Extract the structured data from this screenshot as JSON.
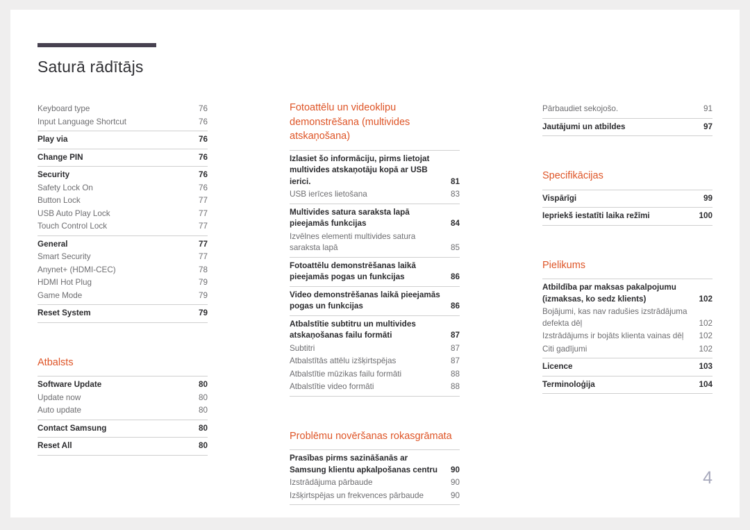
{
  "document": {
    "title": "Saturā rādītājs",
    "folio": "4",
    "accent_color": "#de5426",
    "rule_color": "#474150"
  },
  "columns": [
    {
      "name": "column-left",
      "blocks": [
        {
          "type": "group",
          "rule_top": false,
          "entries": [
            {
              "level": 2,
              "label": "Keyboard type",
              "page": "76"
            },
            {
              "level": 2,
              "label": "Input Language Shortcut",
              "page": "76"
            }
          ]
        },
        {
          "type": "group",
          "rule_top": true,
          "entries": [
            {
              "level": 1,
              "label": "Play via",
              "page": "76"
            }
          ]
        },
        {
          "type": "group",
          "rule_top": true,
          "entries": [
            {
              "level": 1,
              "label": "Change PIN",
              "page": "76"
            }
          ]
        },
        {
          "type": "group",
          "rule_top": true,
          "entries": [
            {
              "level": 1,
              "label": "Security",
              "page": "76"
            },
            {
              "level": 2,
              "label": "Safety Lock On",
              "page": "76"
            },
            {
              "level": 2,
              "label": "Button Lock",
              "page": "77"
            },
            {
              "level": 2,
              "label": "USB Auto Play Lock",
              "page": "77"
            },
            {
              "level": 2,
              "label": "Touch Control Lock",
              "page": "77"
            }
          ]
        },
        {
          "type": "group",
          "rule_top": true,
          "entries": [
            {
              "level": 1,
              "label": "General",
              "page": "77"
            },
            {
              "level": 2,
              "label": "Smart Security",
              "page": "77"
            },
            {
              "level": 2,
              "label": "Anynet+ (HDMI-CEC)",
              "page": "78"
            },
            {
              "level": 2,
              "label": "HDMI Hot Plug",
              "page": "79"
            },
            {
              "level": 2,
              "label": "Game Mode",
              "page": "79"
            }
          ]
        },
        {
          "type": "group",
          "rule_top": true,
          "entries": [
            {
              "level": 1,
              "label": "Reset System",
              "page": "79"
            }
          ]
        },
        {
          "type": "heading",
          "text": "Atbalsts",
          "spaced": true
        },
        {
          "type": "group",
          "rule_top": true,
          "entries": [
            {
              "level": 1,
              "label": "Software Update",
              "page": "80"
            },
            {
              "level": 2,
              "label": "Update now",
              "page": "80"
            },
            {
              "level": 2,
              "label": "Auto update",
              "page": "80"
            }
          ]
        },
        {
          "type": "group",
          "rule_top": true,
          "entries": [
            {
              "level": 1,
              "label": "Contact Samsung",
              "page": "80"
            }
          ]
        },
        {
          "type": "group",
          "rule_top": true,
          "entries": [
            {
              "level": 1,
              "label": "Reset All",
              "page": "80"
            }
          ]
        }
      ]
    },
    {
      "name": "column-middle",
      "blocks": [
        {
          "type": "heading",
          "text": "Fotoattēlu un videoklipu demonstrēšana (multivides atskaņošana)",
          "spaced": false
        },
        {
          "type": "group",
          "rule_top": true,
          "entries": [
            {
              "level": 1,
              "label": "Izlasiet šo informāciju, pirms lietojat multivides atskaņotāju kopā ar USB ierici.",
              "page": "81"
            },
            {
              "level": 2,
              "label": "USB ierīces lietošana",
              "page": "83"
            }
          ]
        },
        {
          "type": "group",
          "rule_top": true,
          "entries": [
            {
              "level": 1,
              "label": "Multivides satura saraksta lapā pieejamās funkcijas",
              "page": "84"
            },
            {
              "level": 2,
              "label": "Izvēlnes elementi multivides satura saraksta lapā",
              "page": "85"
            }
          ]
        },
        {
          "type": "group",
          "rule_top": true,
          "entries": [
            {
              "level": 1,
              "label": "Fotoattēlu demonstrēšanas laikā pieejamās pogas un funkcijas",
              "page": "86"
            }
          ]
        },
        {
          "type": "group",
          "rule_top": true,
          "entries": [
            {
              "level": 1,
              "label": "Video demonstrēšanas laikā pieejamās pogas un funkcijas",
              "page": "86"
            }
          ]
        },
        {
          "type": "group",
          "rule_top": true,
          "entries": [
            {
              "level": 1,
              "label": "Atbalstītie subtitru un multivides atskaņošanas failu formāti",
              "page": "87"
            },
            {
              "level": 2,
              "label": "Subtitri",
              "page": "87"
            },
            {
              "level": 2,
              "label": "Atbalstītās attēlu izšķirtspējas",
              "page": "87"
            },
            {
              "level": 2,
              "label": "Atbalstītie mūzikas failu formāti",
              "page": "88"
            },
            {
              "level": 2,
              "label": "Atbalstītie video formāti",
              "page": "88"
            }
          ]
        },
        {
          "type": "heading",
          "text": "Problēmu novēršanas rokasgrāmata",
          "spaced": true
        },
        {
          "type": "group",
          "rule_top": true,
          "entries": [
            {
              "level": 1,
              "label": "Prasības pirms sazināšanās ar Samsung klientu apkalpošanas centru",
              "page": "90"
            },
            {
              "level": 2,
              "label": "Izstrādājuma pārbaude",
              "page": "90"
            },
            {
              "level": 2,
              "label": "Izšķirtspējas un frekvences pārbaude",
              "page": "90"
            }
          ]
        }
      ]
    },
    {
      "name": "column-right",
      "blocks": [
        {
          "type": "group",
          "rule_top": false,
          "entries": [
            {
              "level": 2,
              "label": "Pārbaudiet sekojošo.",
              "page": "91"
            }
          ]
        },
        {
          "type": "group",
          "rule_top": true,
          "entries": [
            {
              "level": 1,
              "label": "Jautājumi un atbildes",
              "page": "97"
            }
          ]
        },
        {
          "type": "heading",
          "text": "Specifikācijas",
          "spaced": true
        },
        {
          "type": "group",
          "rule_top": true,
          "entries": [
            {
              "level": 1,
              "label": "Vispārīgi",
              "page": "99"
            }
          ]
        },
        {
          "type": "group",
          "rule_top": true,
          "entries": [
            {
              "level": 1,
              "label": "Iepriekš iestatīti laika režīmi",
              "page": "100"
            }
          ]
        },
        {
          "type": "heading",
          "text": "Pielikums",
          "spaced": true
        },
        {
          "type": "group",
          "rule_top": true,
          "entries": [
            {
              "level": 1,
              "label": "Atbildība par maksas pakalpojumu (izmaksas, ko sedz klients)",
              "page": "102"
            },
            {
              "level": 2,
              "label": "Bojājumi, kas nav radušies izstrādājuma defekta dēļ",
              "page": "102"
            },
            {
              "level": 2,
              "label": "Izstrādājums ir bojāts klienta vainas dēļ",
              "page": "102"
            },
            {
              "level": 2,
              "label": "Citi gadījumi",
              "page": "102"
            }
          ]
        },
        {
          "type": "group",
          "rule_top": true,
          "entries": [
            {
              "level": 1,
              "label": "Licence",
              "page": "103"
            }
          ]
        },
        {
          "type": "group",
          "rule_top": true,
          "entries": [
            {
              "level": 1,
              "label": "Terminoloģija",
              "page": "104"
            }
          ]
        }
      ]
    }
  ]
}
